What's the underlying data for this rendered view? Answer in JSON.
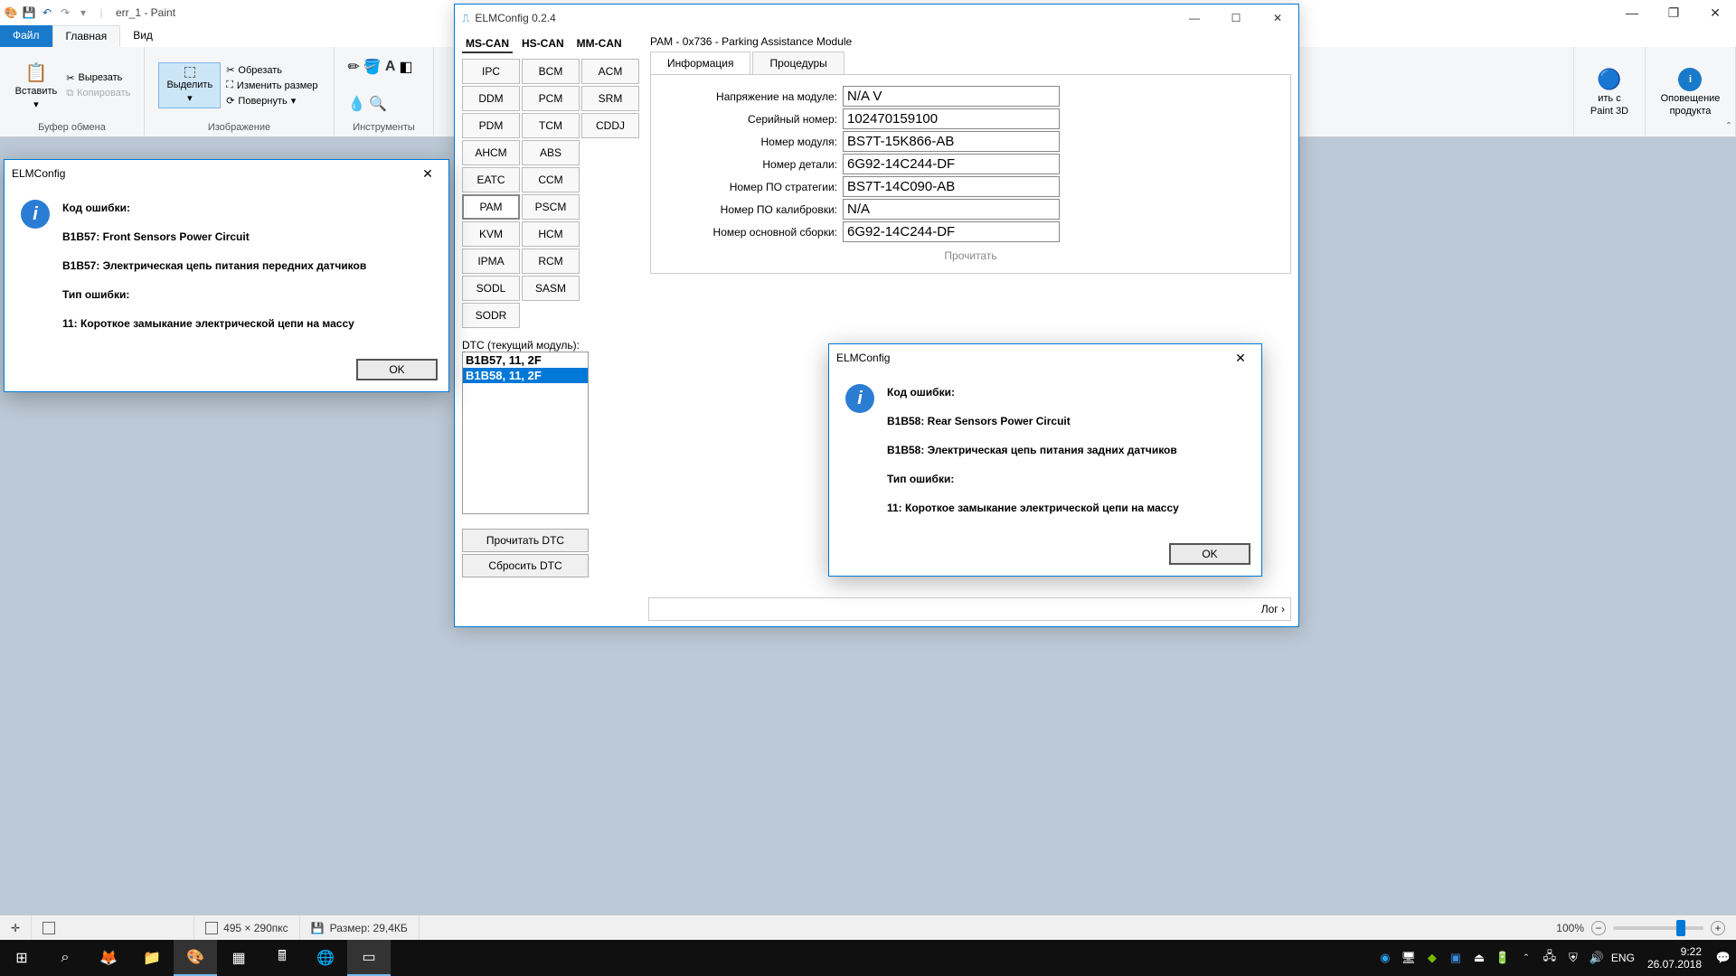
{
  "paint": {
    "title": "err_1 - Paint",
    "tabs": {
      "file": "Файл",
      "home": "Главная",
      "view": "Вид"
    },
    "ribbon": {
      "clipboard": {
        "paste": "Вставить",
        "cut": "Вырезать",
        "copy": "Копировать",
        "label": "Буфер обмена"
      },
      "image": {
        "select": "Выделить",
        "crop": "Обрезать",
        "resize": "Изменить размер",
        "rotate": "Повернуть",
        "label": "Изображение"
      },
      "tools": {
        "label": "Инструменты"
      },
      "paint3d": {
        "line1": "ить с",
        "line2": "Paint 3D"
      },
      "alert": {
        "line1": "Оповещение",
        "line2": "продукта"
      }
    },
    "status": {
      "dims": "495 × 290пкс",
      "size": "Размер: 29,4КБ",
      "zoom": "100%"
    }
  },
  "elm": {
    "title": "ELMConfig 0.2.4",
    "can_tabs": [
      "MS-CAN",
      "HS-CAN",
      "MM-CAN"
    ],
    "modules": [
      "IPC",
      "BCM",
      "ACM",
      "DDM",
      "PCM",
      "SRM",
      "PDM",
      "TCM",
      "CDDJ",
      "AHCM",
      "ABS",
      "",
      "EATC",
      "CCM",
      "",
      "PAM",
      "PSCM",
      "",
      "KVM",
      "HCM",
      "",
      "IPMA",
      "RCM",
      "",
      "SODL",
      "SASM",
      "",
      "SODR",
      "",
      ""
    ],
    "active_module": "PAM",
    "module_header": "PAM - 0x736 - Parking Assistance Module",
    "sub_tabs": {
      "info": "Информация",
      "proc": "Процедуры"
    },
    "info": {
      "voltage_lbl": "Напряжение на модуле:",
      "voltage": "N/A V",
      "serial_lbl": "Серийный номер:",
      "serial": "102470159100",
      "modnum_lbl": "Номер модуля:",
      "modnum": "BS7T-15K866-AB",
      "part_lbl": "Номер детали:",
      "part": "6G92-14C244-DF",
      "strategy_lbl": "Номер ПО стратегии:",
      "strategy": "BS7T-14C090-AB",
      "calib_lbl": "Номер ПО калибровки:",
      "calib": "N/A",
      "assy_lbl": "Номер основной сборки:",
      "assy": "6G92-14C244-DF",
      "read_btn": "Прочитать"
    },
    "dtc_label": "DTC (текущий модуль):",
    "dtc_items": [
      "B1B57, 11, 2F",
      "B1B58, 11, 2F"
    ],
    "read_dtc": "Прочитать DTC",
    "reset_dtc": "Сбросить DTC",
    "log_label": "Лог"
  },
  "dialog1": {
    "title": "ELMConfig",
    "code_lbl": "Код ошибки:",
    "line1": "B1B57: Front Sensors Power Circuit",
    "line2": "B1B57: Электрическая цепь питания передних датчиков",
    "type_lbl": "Тип ошибки:",
    "line3": "11: Короткое замыкание электрической цепи на массу",
    "ok": "OK"
  },
  "dialog2": {
    "title": "ELMConfig",
    "code_lbl": "Код ошибки:",
    "line1": "B1B58: Rear Sensors Power Circuit",
    "line2": "B1B58: Электрическая цепь питания задних датчиков",
    "type_lbl": "Тип ошибки:",
    "line3": "11: Короткое замыкание электрической цепи на массу",
    "ok": "OK"
  },
  "taskbar": {
    "lang": "ENG",
    "time": "9:22",
    "date": "26.07.2018"
  }
}
